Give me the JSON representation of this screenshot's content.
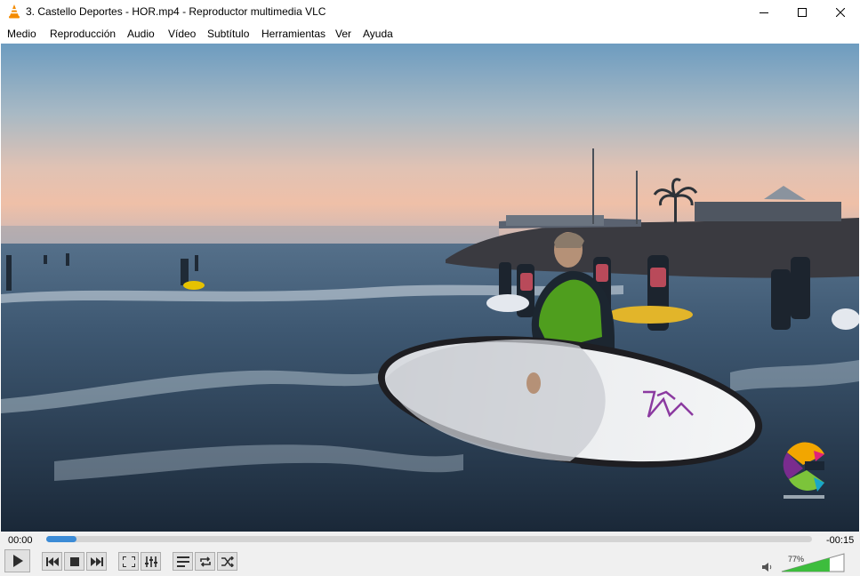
{
  "window": {
    "title": "3. Castello Deportes - HOR.mp4 - Reproductor multimedia VLC",
    "app_icon": "vlc-cone-icon",
    "buttons": {
      "minimize": "minimize-icon",
      "maximize": "maximize-icon",
      "close": "close-icon"
    }
  },
  "menu": {
    "items": [
      "Medio",
      "Reproducción",
      "Audio",
      "Vídeo",
      "Subtítulo",
      "Herramientas",
      "Ver",
      "Ayuda"
    ]
  },
  "video": {
    "watermark_logo": "castello-logo"
  },
  "playback": {
    "elapsed": "00:00",
    "remaining": "-00:15",
    "progress": 0.04
  },
  "controls": {
    "buttons": [
      "play-icon",
      "previous-icon",
      "stop-icon",
      "next-icon",
      "fullscreen-icon",
      "extended-settings-icon",
      "playlist-icon",
      "loop-icon",
      "shuffle-icon"
    ]
  },
  "volume": {
    "label": "77%",
    "level": 0.77,
    "icon": "speaker-icon"
  },
  "colors": {
    "seek_fill": "#3b8bd6",
    "volume_fill": "#3dbd3d",
    "vlc_orange": "#f48b00"
  }
}
